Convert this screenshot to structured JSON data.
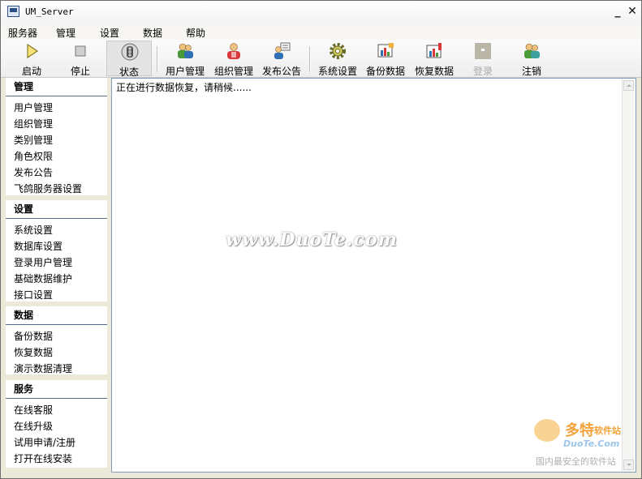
{
  "window": {
    "title": "UM_Server",
    "minimize": "_",
    "close": "✕"
  },
  "menu": [
    "服务器",
    "管理",
    "设置",
    "数据",
    "帮助"
  ],
  "toolbar": [
    {
      "label": "启动",
      "icon": "play-icon",
      "state": "normal"
    },
    {
      "label": "停止",
      "icon": "stop-icon",
      "state": "normal"
    },
    {
      "label": "状态",
      "icon": "traffic-light-icon",
      "state": "pressed"
    },
    {
      "label": "用户管理",
      "icon": "users-icon",
      "state": "normal"
    },
    {
      "label": "组织管理",
      "icon": "organization-icon",
      "state": "normal"
    },
    {
      "label": "发布公告",
      "icon": "announcement-icon",
      "state": "normal"
    },
    {
      "label": "系统设置",
      "icon": "gear-icon",
      "state": "normal"
    },
    {
      "label": "备份数据",
      "icon": "backup-icon",
      "state": "normal"
    },
    {
      "label": "恢复数据",
      "icon": "restore-icon",
      "state": "normal"
    },
    {
      "label": "登录",
      "icon": "login-icon",
      "state": "disabled"
    },
    {
      "label": "注销",
      "icon": "logout-icon",
      "state": "normal"
    }
  ],
  "sidebar": {
    "sections": [
      {
        "title": "管理",
        "items": [
          "用户管理",
          "组织管理",
          "类别管理",
          "角色权限",
          "发布公告",
          "飞鸽服务器设置"
        ]
      },
      {
        "title": "设置",
        "items": [
          "系统设置",
          "数据库设置",
          "登录用户管理",
          "基础数据维护",
          "接口设置"
        ]
      },
      {
        "title": "数据",
        "items": [
          "备份数据",
          "恢复数据",
          "演示数据清理"
        ]
      },
      {
        "title": "服务",
        "items": [
          "在线客服",
          "在线升级",
          "试用申请/注册",
          "打开在线安装"
        ]
      }
    ]
  },
  "content": {
    "status_text": "正在进行数据恢复，请稍候......"
  },
  "watermark": {
    "text": "www.DuoTe.com",
    "logo_big": "多特",
    "logo_small": "软件站",
    "logo_url": "DuoTe.Com",
    "slogan": "国内最安全的软件站"
  },
  "colors": {
    "window_bg": "#ece9d8",
    "content_border": "#7f9db9",
    "section_rule": "#556a8a"
  }
}
